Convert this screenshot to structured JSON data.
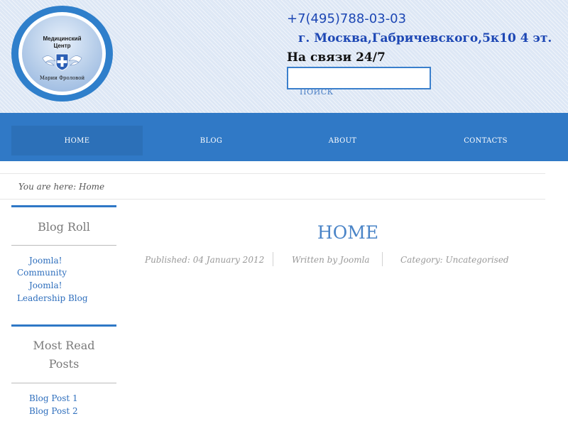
{
  "header": {
    "logo": {
      "title": "Медицинский\nЦентр",
      "subtitle": "Марии Фроловой"
    },
    "phone": "+7(495)788-03-03",
    "address": "г. Москва,Габричевского,5к10 4 эт.",
    "hours": "На связи 24/7",
    "search": {
      "value": "",
      "label": "ПОИСК"
    }
  },
  "nav": {
    "items": [
      {
        "label": "HOME",
        "active": true
      },
      {
        "label": "BLOG",
        "active": false
      },
      {
        "label": "ABOUT",
        "active": false
      },
      {
        "label": "CONTACTS",
        "active": false
      }
    ]
  },
  "breadcrumb": "You are here: Home",
  "sidebar": {
    "blog_roll": {
      "title": "Blog Roll",
      "links": [
        {
          "line1": "Joomla!",
          "line2": "Community"
        },
        {
          "line1": "Joomla!",
          "line2": "Leadership Blog"
        }
      ]
    },
    "most_read": {
      "title_line1": "Most Read",
      "title_line2": "Posts",
      "links": [
        "Blog Post 1",
        "Blog Post 2"
      ]
    }
  },
  "article": {
    "title": "HOME",
    "published": "Published: 04 January 2012",
    "author": "Written by Joomla",
    "category": "Category: Uncategorised"
  },
  "colors": {
    "accent": "#3079c6",
    "header_bg": "#dde7f5",
    "link": "#2f6fbd",
    "phone": "#1d47b4"
  }
}
